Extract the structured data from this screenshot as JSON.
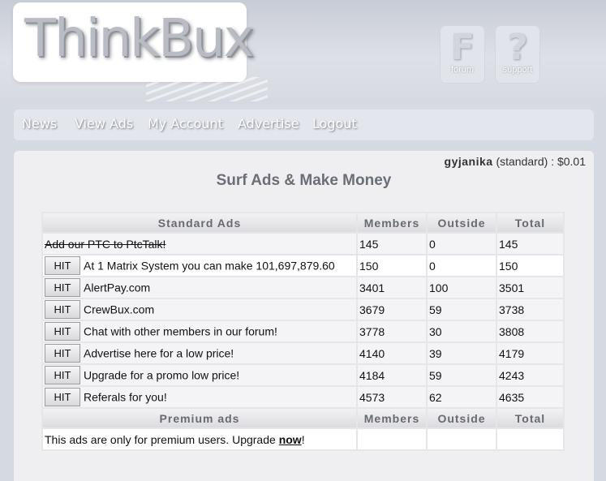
{
  "header": {
    "logo_text": "ThinkBux",
    "forum_glyph": "F",
    "forum_label": "forum",
    "support_glyph": "?",
    "support_label": "support"
  },
  "nav": {
    "items": [
      "News",
      "View Ads",
      "My Account",
      "Advertise",
      "Logout"
    ]
  },
  "user": {
    "name": "gyjanika",
    "membership": " (standard) : ",
    "balance": "$0.01"
  },
  "page_title": "Surf Ads & Make Money",
  "standard_table": {
    "headers": [
      "Standard Ads",
      "Members",
      "Outside",
      "Total"
    ],
    "hit_label": "HIT",
    "rows": [
      {
        "name": "Add our PTC to PtcTalk!",
        "members": "145",
        "outside": "0",
        "total": "145"
      },
      {
        "name": "At 1 Matrix System you can make 101,697,879.60",
        "members": "150",
        "outside": "0",
        "total": "150"
      },
      {
        "name": "AlertPay.com",
        "members": "3401",
        "outside": "100",
        "total": "3501"
      },
      {
        "name": "CrewBux.com",
        "members": "3679",
        "outside": "59",
        "total": "3738"
      },
      {
        "name": "Chat with other members in our forum!",
        "members": "3778",
        "outside": "30",
        "total": "3808"
      },
      {
        "name": "Advertise here for a low price!",
        "members": "4140",
        "outside": "39",
        "total": "4179"
      },
      {
        "name": "Upgrade for a promo low price!",
        "members": "4184",
        "outside": "59",
        "total": "4243"
      },
      {
        "name": "Referals for you!",
        "members": "4573",
        "outside": "62",
        "total": "4635"
      }
    ]
  },
  "premium_table": {
    "headers": [
      "Premium ads",
      "Members",
      "Outside",
      "Total"
    ],
    "message_before": "This ads are only for premium users. Upgrade ",
    "message_link": "now",
    "message_after": "!"
  }
}
